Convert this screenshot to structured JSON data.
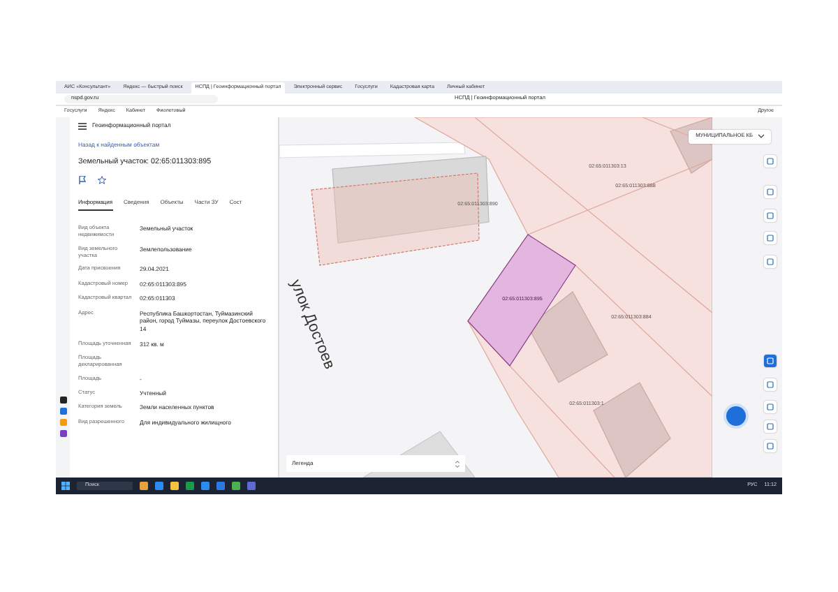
{
  "browser": {
    "tabs": [
      {
        "label": "АИС «Консультант»",
        "selected": false
      },
      {
        "label": "Яндекс — быстрый поиск",
        "selected": false
      },
      {
        "label": "НСПД | Геоинформационный портал",
        "selected": true
      },
      {
        "label": "Электронный сервис",
        "selected": false
      },
      {
        "label": "Госуслуги",
        "selected": false
      },
      {
        "label": "Кадастровая карта",
        "selected": false
      },
      {
        "label": "Личный кабинет",
        "selected": false
      }
    ],
    "address": "nspd.gov.ru",
    "page_title": "НСПД | Геоинформационный портал",
    "bookmarks": [
      "Госуслуги",
      "Яндекс",
      "Кабинет",
      "Фиолетовый"
    ],
    "bookmarks_end": "Другое"
  },
  "panel": {
    "portal_title": "Геоинформационный портал",
    "back_link": "Назад к найденным объектам",
    "object_title": "Земельный участок: 02:65:011303:895",
    "tabs": [
      {
        "label": "Информация",
        "selected": true
      },
      {
        "label": "Сведения",
        "selected": false
      },
      {
        "label": "Объекты",
        "selected": false
      },
      {
        "label": "Части ЗУ",
        "selected": false
      },
      {
        "label": "Сост",
        "selected": false
      }
    ],
    "fields": [
      {
        "label": "Вид объекта недвижимости",
        "value": "Земельный участок"
      },
      {
        "label": "Вид земельного участка",
        "value": "Землепользование"
      },
      {
        "label": "Дата присвоения",
        "value": "29.04.2021"
      },
      {
        "label": "Кадастровый номер",
        "value": "02:65:011303:895"
      },
      {
        "label": "Кадастровый квартал",
        "value": "02:65:011303"
      },
      {
        "label": "Адрес",
        "value": "Республика Башкортостан, Туймазинский район, город Туймазы, переулок Достоевского 14"
      },
      {
        "label": "Площадь уточненная",
        "value": "312 кв. м"
      },
      {
        "label": "Площадь декларированная"
      },
      {
        "label": "Площадь",
        "value": "-"
      },
      {
        "label": "Статус",
        "value": "Учтенный"
      },
      {
        "label": "Категория земель",
        "value": "Земли населенных пунктов"
      },
      {
        "label": "Вид разрешенного",
        "value": "Для индивидуального жилищного"
      }
    ]
  },
  "map": {
    "layer_select": "МУНИЦИПАЛЬНОЕ КБ",
    "street": "улок Достоев",
    "legend": "Легенда",
    "parcels": [
      {
        "label": "02:65:011303:895",
        "selected": true
      },
      {
        "label": "02:65:011303:888",
        "selected": false
      },
      {
        "label": "02:65:011303:13",
        "selected": false
      },
      {
        "label": "02:65:011303:884",
        "selected": false
      },
      {
        "label": "02:65:011303:890",
        "selected": false
      },
      {
        "label": "02:65:011303:1",
        "selected": false
      }
    ]
  },
  "taskbar": {
    "search": "Поиск",
    "language": "РУС",
    "time": "11:12"
  }
}
